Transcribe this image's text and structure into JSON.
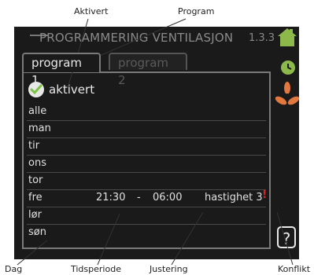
{
  "annotations": {
    "aktivert": "Aktivert",
    "program": "Program",
    "dag": "Dag",
    "tidsperiode": "Tidsperiode",
    "justering": "Justering",
    "konflikt": "Konflikt"
  },
  "header": {
    "title": "PROGRAMMERING VENTILASJON",
    "menu_number": "1.3.3"
  },
  "tabs": [
    {
      "label": "program 1",
      "active": true
    },
    {
      "label": "program 2",
      "active": false
    }
  ],
  "activated": {
    "label": "aktivert",
    "checked": true
  },
  "days": [
    {
      "day": "alle"
    },
    {
      "day": "man"
    },
    {
      "day": "tir"
    },
    {
      "day": "ons"
    },
    {
      "day": "tor"
    },
    {
      "day": "fre",
      "start": "21:30",
      "sep": "-",
      "end": "06:00",
      "adjustment": "hastighet 3",
      "conflict": "!"
    },
    {
      "day": "lør"
    },
    {
      "day": "søn"
    }
  ],
  "side_icons": [
    "house-icon",
    "clock-icon",
    "fan-icon"
  ],
  "help": {
    "label": "?"
  },
  "colors": {
    "screen_bg": "#1a1a1a",
    "border": "#7a7a7a",
    "text": "#e8e8e8",
    "house_green": "#8db84a",
    "fan_orange": "#e07840",
    "conflict_red": "#e02020"
  }
}
